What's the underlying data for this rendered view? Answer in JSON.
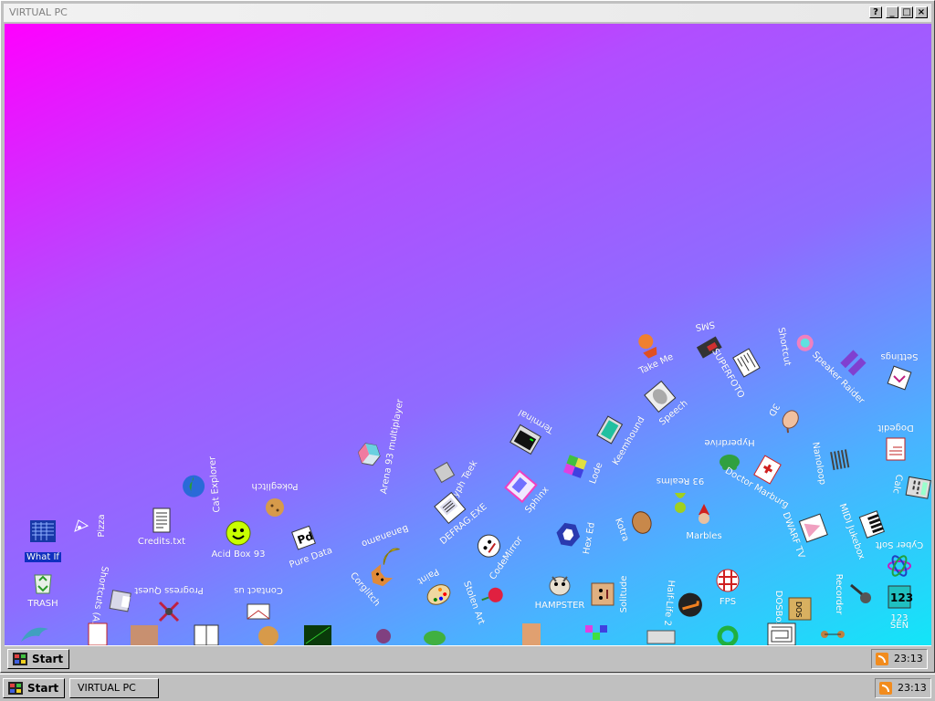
{
  "window": {
    "title": "VIRTUAL PC",
    "buttons": [
      "?",
      "_",
      "□",
      "×"
    ]
  },
  "desktop_icons": [
    {
      "label": "What If",
      "icon": "grid-app-icon",
      "selected": true
    },
    {
      "label": "TRASH",
      "icon": "recycle-bin-icon"
    },
    {
      "label": "Pizza",
      "icon": "pizza-icon"
    },
    {
      "label": "Credits.txt",
      "icon": "text-file-icon"
    },
    {
      "label": "Shortcuts (A:)",
      "icon": "floppy-icon"
    },
    {
      "label": "Progress Quest",
      "icon": "crossed-swords-icon"
    },
    {
      "label": "Cat Explorer",
      "icon": "globe-icon"
    },
    {
      "label": "Acid Box 93",
      "icon": "smiley-icon"
    },
    {
      "label": "Contact us",
      "icon": "mail-icon"
    },
    {
      "label": "Pokeglitch",
      "icon": "cookie-icon"
    },
    {
      "label": "Pure Data",
      "icon": "pd-icon"
    },
    {
      "label": "Corglitch",
      "icon": "corgi-icon"
    },
    {
      "label": "Arena 93 multiplayer",
      "icon": "cube-icon"
    },
    {
      "label": "Bananamo",
      "icon": "banana-icon"
    },
    {
      "label": "Paint",
      "icon": "palette-icon"
    },
    {
      "label": "Glyph Teek",
      "icon": "cart-icon"
    },
    {
      "label": "DEFRAG.EXE",
      "icon": "defrag-icon"
    },
    {
      "label": "Stolen Art",
      "icon": "rose-icon"
    },
    {
      "label": "CodeMirror",
      "icon": "dog-icon"
    },
    {
      "label": "Terminal",
      "icon": "terminal-icon"
    },
    {
      "label": "Sphinx",
      "icon": "floppy-drive-icon"
    },
    {
      "label": "HAMPSTER",
      "icon": "hamster-icon"
    },
    {
      "label": "Hex Ed",
      "icon": "hexagon-icon"
    },
    {
      "label": "Lode",
      "icon": "colorbox-icon"
    },
    {
      "label": "Solitude",
      "icon": "monitor-icon"
    },
    {
      "label": "Keemhound",
      "icon": "potato-icon"
    },
    {
      "label": "Kotra",
      "icon": "face-icon"
    },
    {
      "label": "Half-Life 2",
      "icon": "lambda-icon"
    },
    {
      "label": "93 Realms",
      "icon": "gnome-icon"
    },
    {
      "label": "Marbles",
      "icon": "goo-icon"
    },
    {
      "label": "Hyperdrive",
      "icon": "frog-icon"
    },
    {
      "label": "Speech",
      "icon": "speaker-face-icon"
    },
    {
      "label": "Take Me",
      "icon": "hermit-icon"
    },
    {
      "label": "SMS",
      "icon": "cartridge-icon"
    },
    {
      "label": "SUPERFOTO",
      "icon": "newspaper-icon"
    },
    {
      "label": "3D",
      "icon": "teapot-icon"
    },
    {
      "label": "Doctor Marburg",
      "icon": "doctor-icon"
    },
    {
      "label": "DWARF TV",
      "icon": "pyramid-icon"
    },
    {
      "label": "FPS",
      "icon": "ball-icon"
    },
    {
      "label": "DOSBox",
      "icon": "dosbox-icon"
    },
    {
      "label": "Shortcut",
      "icon": "shortcut-icon"
    },
    {
      "label": "Speaker Raider",
      "icon": "speakers-icon"
    },
    {
      "label": "Nanoloop",
      "icon": "pattern-icon"
    },
    {
      "label": "MIDI Jukebox",
      "icon": "piano-icon"
    },
    {
      "label": "Recorder",
      "icon": "microphone-icon"
    },
    {
      "label": "Cyber Soft",
      "icon": "atom-icon"
    },
    {
      "label": "Calc",
      "icon": "calculator-icon"
    },
    {
      "label": "Dogedit",
      "icon": "notepad-icon"
    },
    {
      "label": "Settings",
      "icon": "settings-icon"
    },
    {
      "label": "123",
      "icon": "numbers-icon"
    },
    {
      "label": "SEN",
      "icon": "sen-icon"
    }
  ],
  "inner_taskbar": {
    "start_label": "Start",
    "clock": "23:13"
  },
  "outer_taskbar": {
    "start_label": "Start",
    "task_label": "VIRTUAL PC",
    "clock": "23:13"
  },
  "colors": {
    "gradient_top_left": "#ff00ff",
    "gradient_bottom_right": "#12e6f8",
    "chrome": "#c0c0c0",
    "selection": "#1030c0"
  }
}
